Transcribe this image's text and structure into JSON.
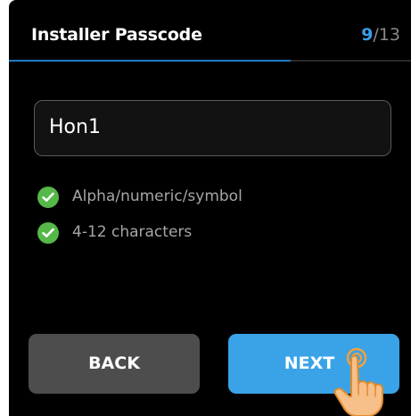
{
  "header": {
    "title": "Installer Passcode",
    "step_current": "9",
    "step_total": "/13",
    "progress_fraction": 0.7
  },
  "passcode": {
    "value": "Hon1"
  },
  "requirements": [
    {
      "label": "Alpha/numeric/symbol",
      "met": true
    },
    {
      "label": "4-12 characters",
      "met": true
    }
  ],
  "buttons": {
    "back_label": "BACK",
    "next_label": "NEXT"
  },
  "colors": {
    "accent": "#3aa3e8",
    "check": "#55b848",
    "back_button": "#4d4d4d",
    "background": "#000000"
  },
  "icons": {
    "check": "check-circle-icon",
    "pointer": "tap-hand-icon"
  }
}
